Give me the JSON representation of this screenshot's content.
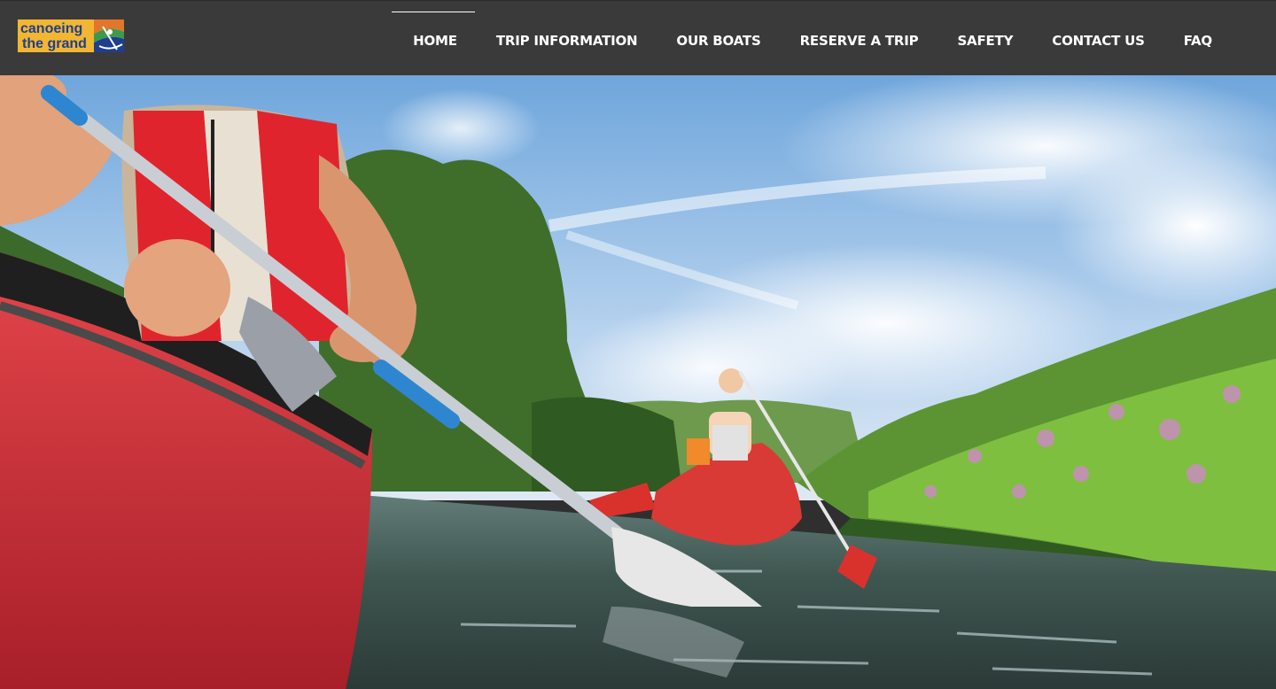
{
  "header": {
    "logo": {
      "line1": "canoeing",
      "line2": "the grand",
      "icon": "canoe-paddler-logo-icon"
    },
    "nav": [
      {
        "label": "HOME",
        "active": true
      },
      {
        "label": "TRIP INFORMATION",
        "active": false
      },
      {
        "label": "OUR BOATS",
        "active": false
      },
      {
        "label": "RESERVE A TRIP",
        "active": false
      },
      {
        "label": "SAFETY",
        "active": false
      },
      {
        "label": "CONTACT US",
        "active": false
      },
      {
        "label": "FAQ",
        "active": false
      }
    ]
  },
  "hero": {
    "image": "canoeists-paddling-on-river-photo"
  },
  "colors": {
    "header_bg": "#3a3a3a",
    "nav_text": "#ffffff",
    "logo_yellow": "#f2b632",
    "logo_blue": "#1e3f8f",
    "canoe_red": "#d8323a",
    "paddle_blue": "#2f86d0"
  }
}
